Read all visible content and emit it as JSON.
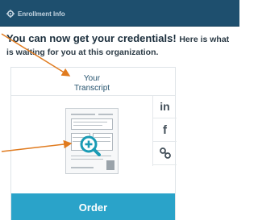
{
  "header": {
    "title": "Enrollment Info",
    "icon": "gear-icon"
  },
  "intro": {
    "headline": "You can now get your credentials!",
    "sub_part1": "Here is what",
    "sub_part2": "is waiting for you at this organization."
  },
  "card": {
    "title_line1": "Your",
    "title_line2": "Transcript",
    "preview_icon": "transcript-document-icon",
    "zoom_icon": "zoom-in-icon",
    "share": {
      "linkedin_label": "in",
      "facebook_label": "f",
      "link_icon": "link-icon"
    },
    "order_label": "Order"
  },
  "colors": {
    "header_bg": "#1e4f6e",
    "accent": "#2aa3c9",
    "annotation_arrow": "#e07b1f"
  }
}
